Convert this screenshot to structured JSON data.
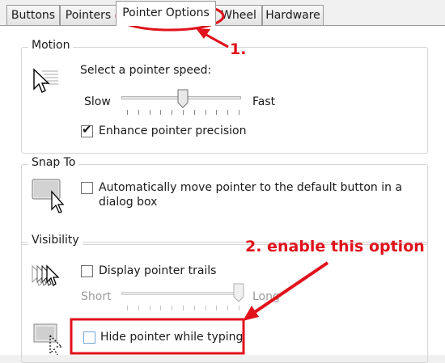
{
  "tabs": [
    {
      "label": "Buttons"
    },
    {
      "label": "Pointers"
    },
    {
      "label": "Pointer Options"
    },
    {
      "label": "Wheel"
    },
    {
      "label": "Hardware"
    }
  ],
  "motion": {
    "title": "Motion",
    "speed_label": "Select a pointer speed:",
    "slow_label": "Slow",
    "fast_label": "Fast",
    "speed_level": 0.5,
    "enhance_label": "Enhance pointer precision",
    "enhance_checked": true
  },
  "snap_to": {
    "title": "Snap To",
    "auto_move_label_line1": "Automatically move pointer to the default button in a",
    "auto_move_label_line2": "dialog box",
    "auto_move_checked": false
  },
  "visibility": {
    "title": "Visibility",
    "trails_label": "Display pointer trails",
    "trails_checked": false,
    "short_label": "Short",
    "long_label": "Long",
    "trails_level": 1.0,
    "hide_label": "Hide pointer while typing",
    "hide_checked": false
  },
  "annotations": {
    "step1": "1.",
    "step2": "2. enable this option",
    "color": "#e0121b"
  }
}
